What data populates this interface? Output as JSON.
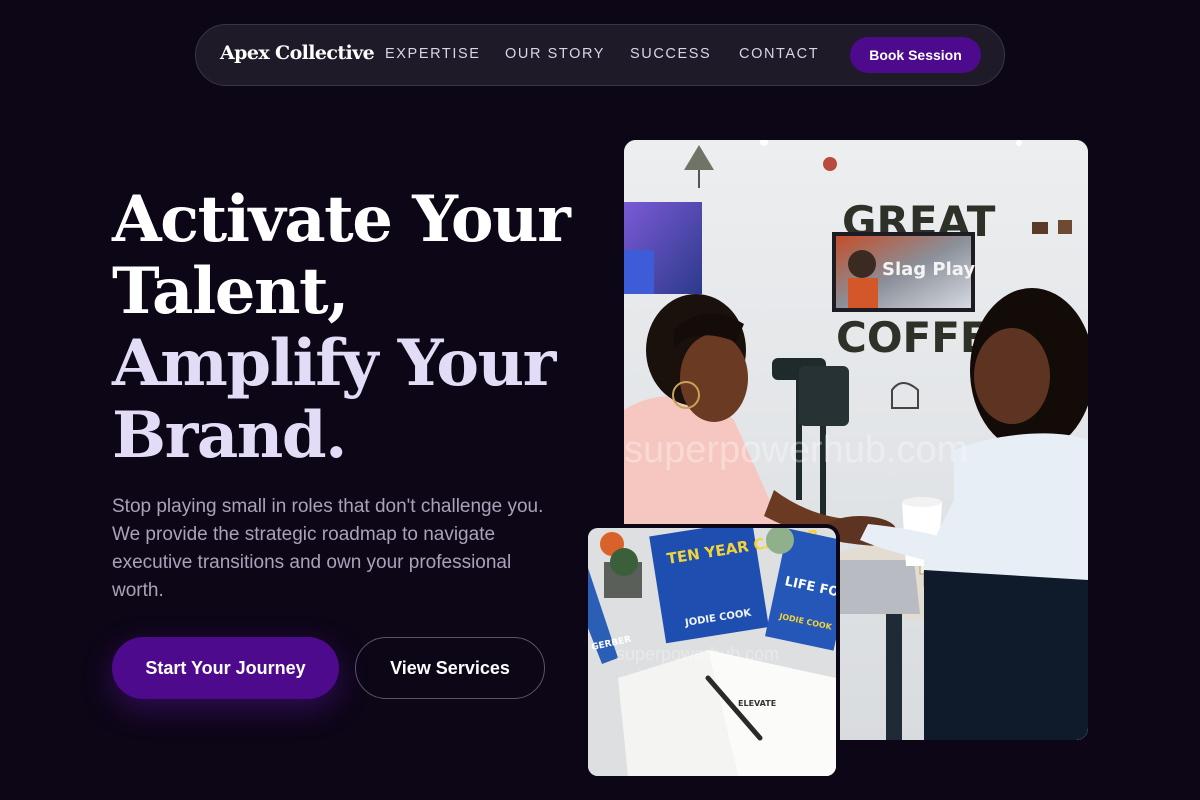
{
  "nav": {
    "brand": "Apex Collective",
    "links": [
      {
        "label": "EXPERTISE"
      },
      {
        "label": "OUR STORY"
      },
      {
        "label": "SUCCESS"
      },
      {
        "label": "CONTACT"
      }
    ],
    "cta_label": "Book Session"
  },
  "hero": {
    "headline": {
      "line1": "Activate Your",
      "line2": "Talent,",
      "line3": "Amplify Your",
      "line4": "Brand."
    },
    "subtext": "Stop playing small in roles that don't challenge you. We provide the strategic roadmap to navigate executive transitions and own your professional worth.",
    "primary_button": "Start Your Journey",
    "secondary_button": "View Services"
  },
  "images": {
    "main": {
      "wall_sign_top": "GREAT",
      "wall_sign_bottom": "COFFEE",
      "tv_text": "Slag Play",
      "watermark": "superpowerhub.com"
    },
    "small": {
      "book_title": "TEN YEAR CAREER",
      "book_author": "JODIE COOK",
      "book2_text": "LIFE FOREVER",
      "book2_author": "JODIE COOK",
      "book3_text": "GERBER",
      "notebook_text": "ELEVATE",
      "watermark": "superpowerhub.com"
    }
  },
  "colors": {
    "background": "#0d0617",
    "accent": "#4d0a8c",
    "nav_surface": "#221e2c",
    "muted_text": "#a9a3b8"
  }
}
